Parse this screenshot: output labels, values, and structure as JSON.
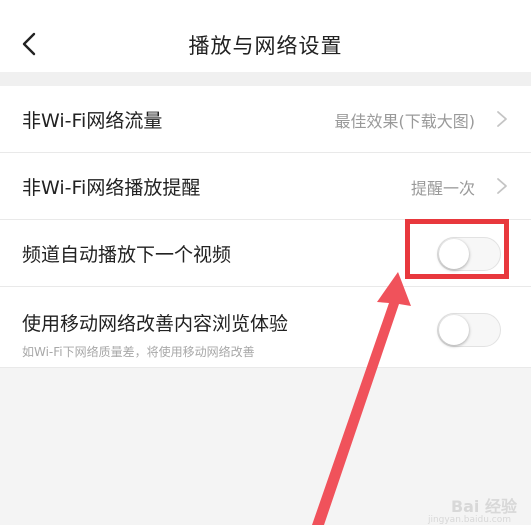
{
  "header": {
    "title": "播放与网络设置"
  },
  "settings": [
    {
      "label": "非Wi-Fi网络流量",
      "value": "最佳效果(下载大图)"
    },
    {
      "label": "非Wi-Fi网络播放提醒",
      "value": "提醒一次"
    },
    {
      "label": "频道自动播放下一个视频",
      "toggle_on": false
    },
    {
      "label": "使用移动网络改善内容浏览体验",
      "sublabel": "如Wi-Fi下网络质量差，将使用移动网络改善",
      "toggle_on": false
    }
  ],
  "annotation": {
    "highlight_color": "#e8383d"
  },
  "watermark": {
    "text": "Bai 经验",
    "sub": "jingyan.baidu.com"
  }
}
